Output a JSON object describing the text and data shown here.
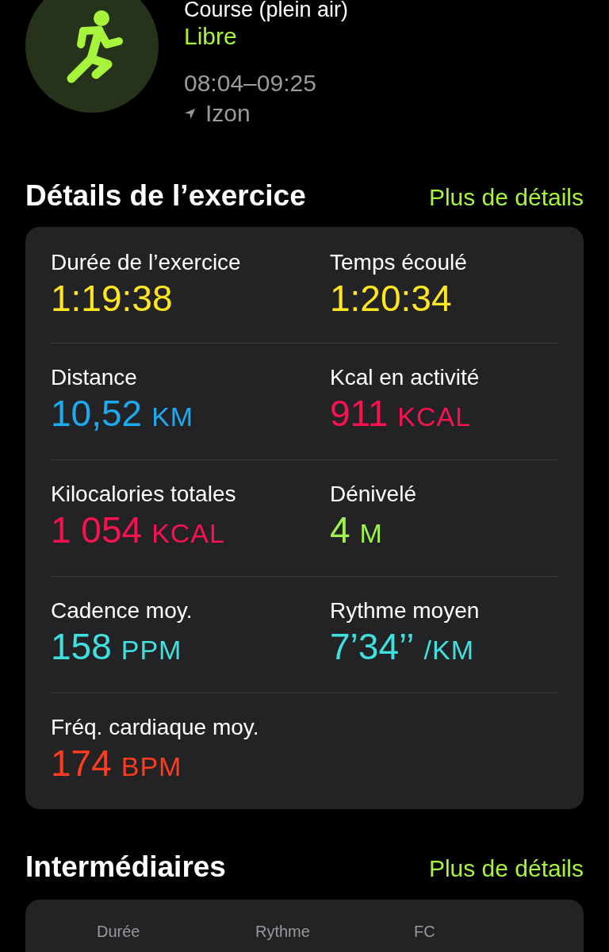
{
  "workout": {
    "title": "Course (plein air)",
    "type": "Libre",
    "time": "08:04–09:25",
    "location": "Izon"
  },
  "details": {
    "heading": "Détails de l’exercice",
    "link": "Plus de détails",
    "metrics": [
      {
        "label": "Durée de l’exercice",
        "value": "1:19:38",
        "color": "#ffe620"
      },
      {
        "label": "Temps écoulé",
        "value": "1:20:34",
        "color": "#ffe620"
      },
      {
        "label": "Distance",
        "value": "10,52",
        "unit": "KM",
        "color": "#1eaaf1"
      },
      {
        "label": "Kcal en activité",
        "value": "911",
        "unit": "KCAL",
        "color": "#fa1150"
      },
      {
        "label": "Kilocalories totales",
        "value": "1 054",
        "unit": "KCAL",
        "color": "#fa1150"
      },
      {
        "label": "Dénivelé",
        "value": "4",
        "unit": "M",
        "color": "#a0f050"
      },
      {
        "label": "Cadence moy.",
        "value": "158",
        "unit": "PPM",
        "color": "#40e0e0"
      },
      {
        "label": "Rythme moyen",
        "value": "7’34’’",
        "unit": "/KM",
        "color": "#40e0e0"
      },
      {
        "label": "Fréq. cardiaque moy.",
        "value": "174",
        "unit": "BPM",
        "color": "#ff3b20"
      }
    ]
  },
  "splits": {
    "heading": "Intermédiaires",
    "link": "Plus de détails",
    "columns": [
      "Durée",
      "Rythme",
      "FC"
    ]
  }
}
